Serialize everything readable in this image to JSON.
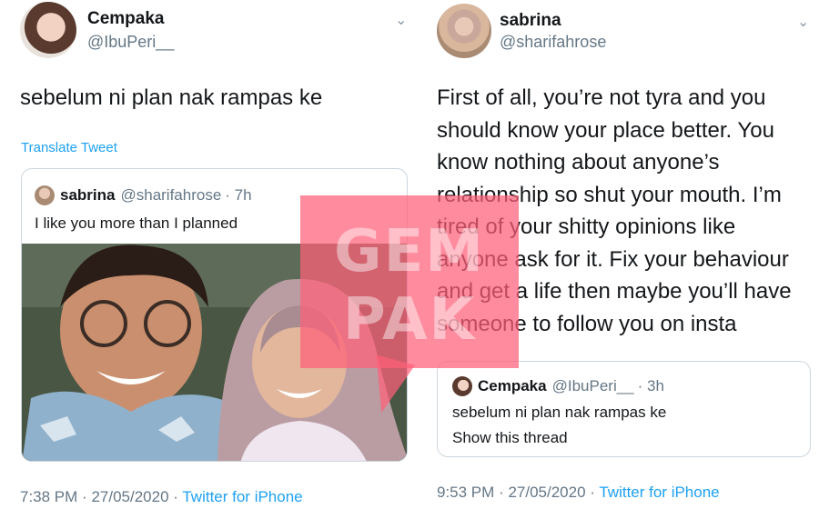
{
  "left_tweet": {
    "author_name": "Cempaka",
    "author_handle": "@IbuPeri__",
    "text": "sebelum ni plan nak rampas ke",
    "translate_label": "Translate Tweet",
    "quoted": {
      "author_name": "sabrina",
      "author_handle": "@sharifahrose",
      "age": "· 7h",
      "text": "I like you more than I planned"
    },
    "time": "7:38 PM",
    "date": "27/05/2020",
    "source": "Twitter for iPhone"
  },
  "right_tweet": {
    "author_name": "sabrina",
    "author_handle": "@sharifahrose",
    "text": "First of all, you’re not tyra and you should know your place better. You know nothing about anyone’s relationship so shut your mouth. I’m tired of your shitty opinions like anyone ask for it. Fix your behaviour and get a life then maybe you’ll have someone to follow you on insta",
    "quoted": {
      "author_name": "Cempaka",
      "author_handle": "@IbuPeri__",
      "age": "· 3h",
      "text": "sebelum ni plan nak rampas ke",
      "show_thread_label": "Show this thread"
    },
    "time": "9:53 PM",
    "date": "27/05/2020",
    "source": "Twitter for iPhone"
  },
  "watermark": {
    "line1": "GEM",
    "line2": "PAK"
  },
  "icons": {
    "menu": "chevron-down-icon"
  },
  "colors": {
    "link": "#1da1f2",
    "muted": "#657786",
    "watermark": "#ff5f78"
  }
}
